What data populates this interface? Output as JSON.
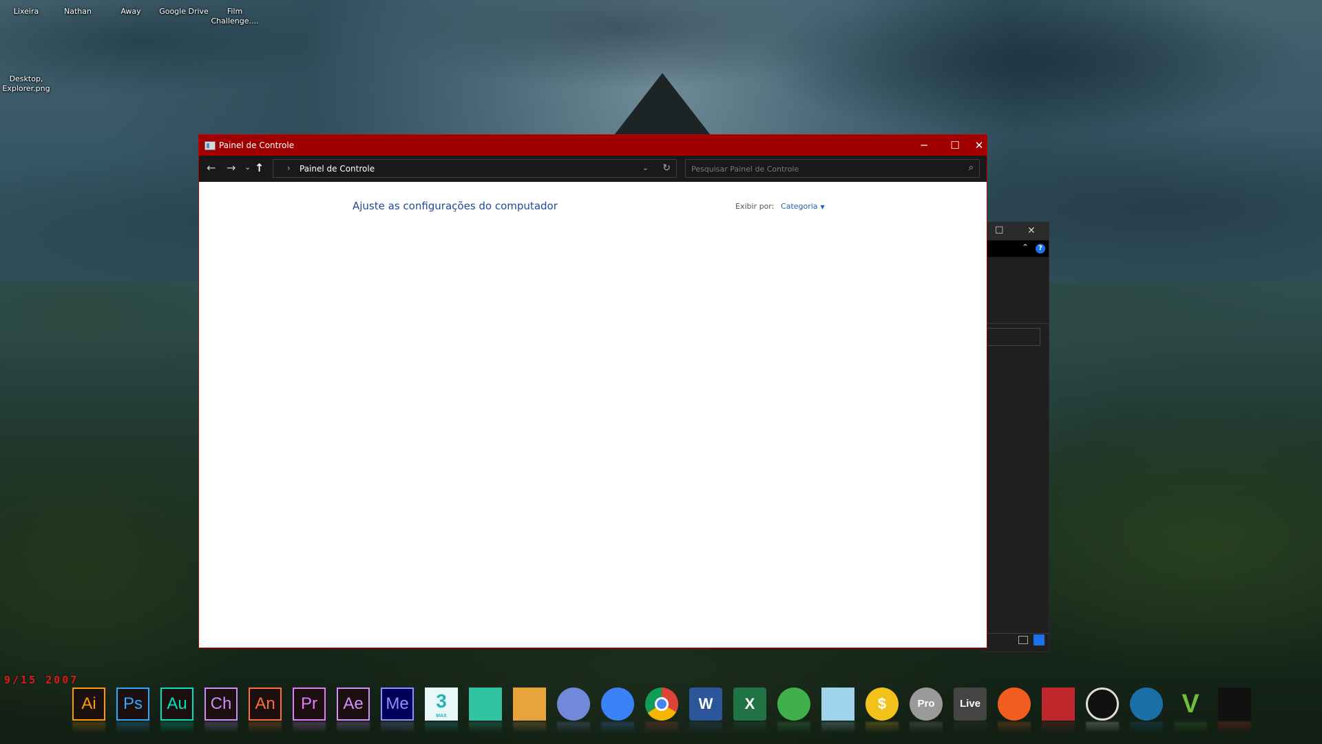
{
  "desktop": {
    "icons": [
      {
        "label": "Lixeira",
        "name": "recycle-bin-icon"
      },
      {
        "label": "Nathan",
        "name": "user-folder-icon"
      },
      {
        "label": "Away",
        "name": "away-icon"
      },
      {
        "label": "Google Drive",
        "name": "google-drive-icon"
      },
      {
        "label": "Film Challenge....",
        "name": "film-challenge-icon"
      },
      {
        "label": "Desktop, Explorer.png",
        "name": "image-file-icon"
      }
    ],
    "date_label": "9/15 2007"
  },
  "window": {
    "title": "Painel de Controle",
    "minimize": "─",
    "maximize": "☐",
    "close": "✕",
    "nav": {
      "back": "←",
      "forward": "→",
      "recent": "⌄",
      "up": "↑"
    },
    "address": {
      "separator": "›",
      "path": "Painel de Controle",
      "dropdown": "⌄",
      "refresh": "↻"
    },
    "search": {
      "placeholder": "Pesquisar Painel de Controle",
      "value": ""
    },
    "heading": "Ajuste as configurações do computador",
    "view_by_label": "Exibir por:",
    "view_by_value": "Categoria"
  },
  "background_window": {
    "maximize": "☐",
    "close": "✕",
    "collapse": "⌃",
    "help": "?"
  },
  "dock": {
    "items": [
      {
        "label": "Ai",
        "name": "illustrator-icon",
        "color": "#ff9a00"
      },
      {
        "label": "Ps",
        "name": "photoshop-icon",
        "color": "#31a8ff"
      },
      {
        "label": "Au",
        "name": "audition-icon",
        "color": "#00e4bb"
      },
      {
        "label": "Ch",
        "name": "character-animator-icon",
        "color": "#cf8cff"
      },
      {
        "label": "An",
        "name": "animate-icon",
        "color": "#ff6d3a"
      },
      {
        "label": "Pr",
        "name": "premiere-icon",
        "color": "#e77bff"
      },
      {
        "label": "Ae",
        "name": "after-effects-icon",
        "color": "#d291ff"
      },
      {
        "label": "Me",
        "name": "media-encoder-icon",
        "color": "#8f8fff"
      },
      {
        "label": "3",
        "sub": "MAX",
        "name": "3ds-max-icon",
        "color": "#23b5b5"
      },
      {
        "label": "",
        "name": "streamlabs-icon",
        "color": "#31c3a2"
      },
      {
        "label": "",
        "name": "pineapple-drink-icon",
        "color": "#e8a33a"
      },
      {
        "label": "",
        "name": "discord-icon",
        "color": "#7289da"
      },
      {
        "label": "",
        "name": "cloud-upload-icon",
        "color": "#3b82f6"
      },
      {
        "label": "",
        "name": "chrome-icon",
        "color": "#db4437"
      },
      {
        "label": "W",
        "name": "word-icon",
        "color": "#2b579a"
      },
      {
        "label": "X",
        "name": "excel-icon",
        "color": "#217346"
      },
      {
        "label": "",
        "name": "scrivener-icon",
        "color": "#3fb04a"
      },
      {
        "label": "",
        "name": "notepad-icon",
        "color": "#9fd3ea"
      },
      {
        "label": "$",
        "name": "metatrader-icon",
        "color": "#f2c21a"
      },
      {
        "label": "Pro",
        "name": "google-earth-pro-icon",
        "color": "#9a9a9a"
      },
      {
        "label": "Live",
        "name": "ableton-live-icon",
        "color": "#444444"
      },
      {
        "label": "",
        "name": "audacity-icon",
        "color": "#f25c1f"
      },
      {
        "label": "",
        "name": "red-box-icon",
        "color": "#c0272d"
      },
      {
        "label": "",
        "name": "sync-icon",
        "color": "#dddddd"
      },
      {
        "label": "",
        "name": "steam-icon",
        "color": "#1b6fa8"
      },
      {
        "label": "V",
        "name": "gta-v-icon",
        "color": "#4a8a2a"
      },
      {
        "label": "",
        "name": "need-for-speed-icon",
        "color": "#e02020"
      }
    ]
  }
}
